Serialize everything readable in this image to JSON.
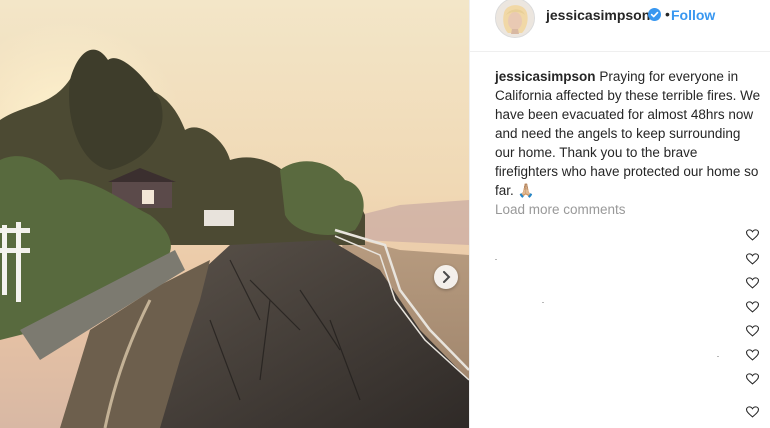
{
  "post": {
    "username": "jessicasimpson",
    "separator": "•",
    "follow_label": "Follow",
    "caption_user": "jessicasimpson",
    "caption_text": "Praying for everyone in California affected by these terrible fires. We have been evacuated for almost 48hrs now and need the angels to keep surrounding our home. Thank you to the brave firefighters who have protected our home so far. 🙏🏼",
    "load_more_label": "Load more comments"
  },
  "icons": {
    "verified": "verified-badge-icon",
    "like": "heart-outline-icon",
    "next": "chevron-right-icon"
  },
  "colors": {
    "accent": "#3897f0",
    "muted": "#999999",
    "text": "#262626"
  },
  "comments": [
    {
      "text": ""
    },
    {
      "text": ""
    },
    {
      "text": ""
    },
    {
      "text": ""
    },
    {
      "text": ""
    },
    {
      "text": ""
    },
    {
      "text": ""
    },
    {
      "text": ""
    }
  ]
}
